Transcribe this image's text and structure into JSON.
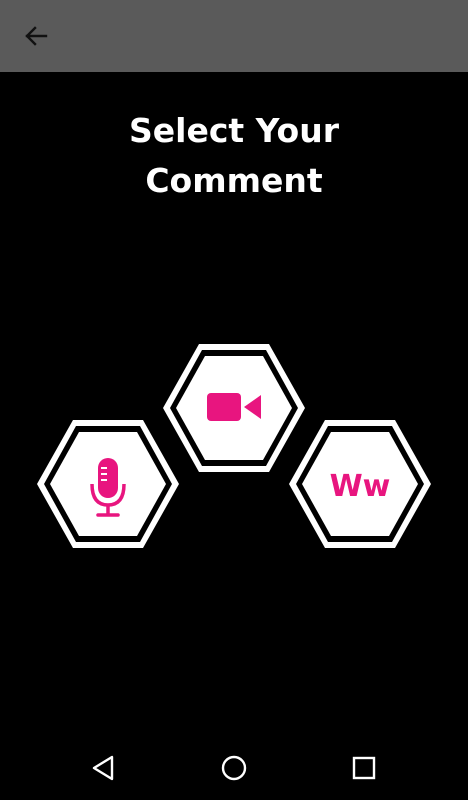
{
  "header": {
    "back_icon": "arrow-left-icon"
  },
  "main": {
    "title_line1": "Select Your",
    "title_line2": "Comment",
    "options": [
      {
        "icon": "video-camera-icon"
      },
      {
        "icon": "microphone-icon"
      },
      {
        "icon": "text-icon",
        "label": "Ww"
      }
    ]
  },
  "navigation": {
    "back_icon": "triangle-back-icon",
    "home_icon": "circle-home-icon",
    "recents_icon": "square-recents-icon"
  },
  "colors": {
    "app_bar": "#5a5a5a",
    "background": "#000000",
    "accent": "#e8157f",
    "hex_fill": "#ffffff"
  }
}
